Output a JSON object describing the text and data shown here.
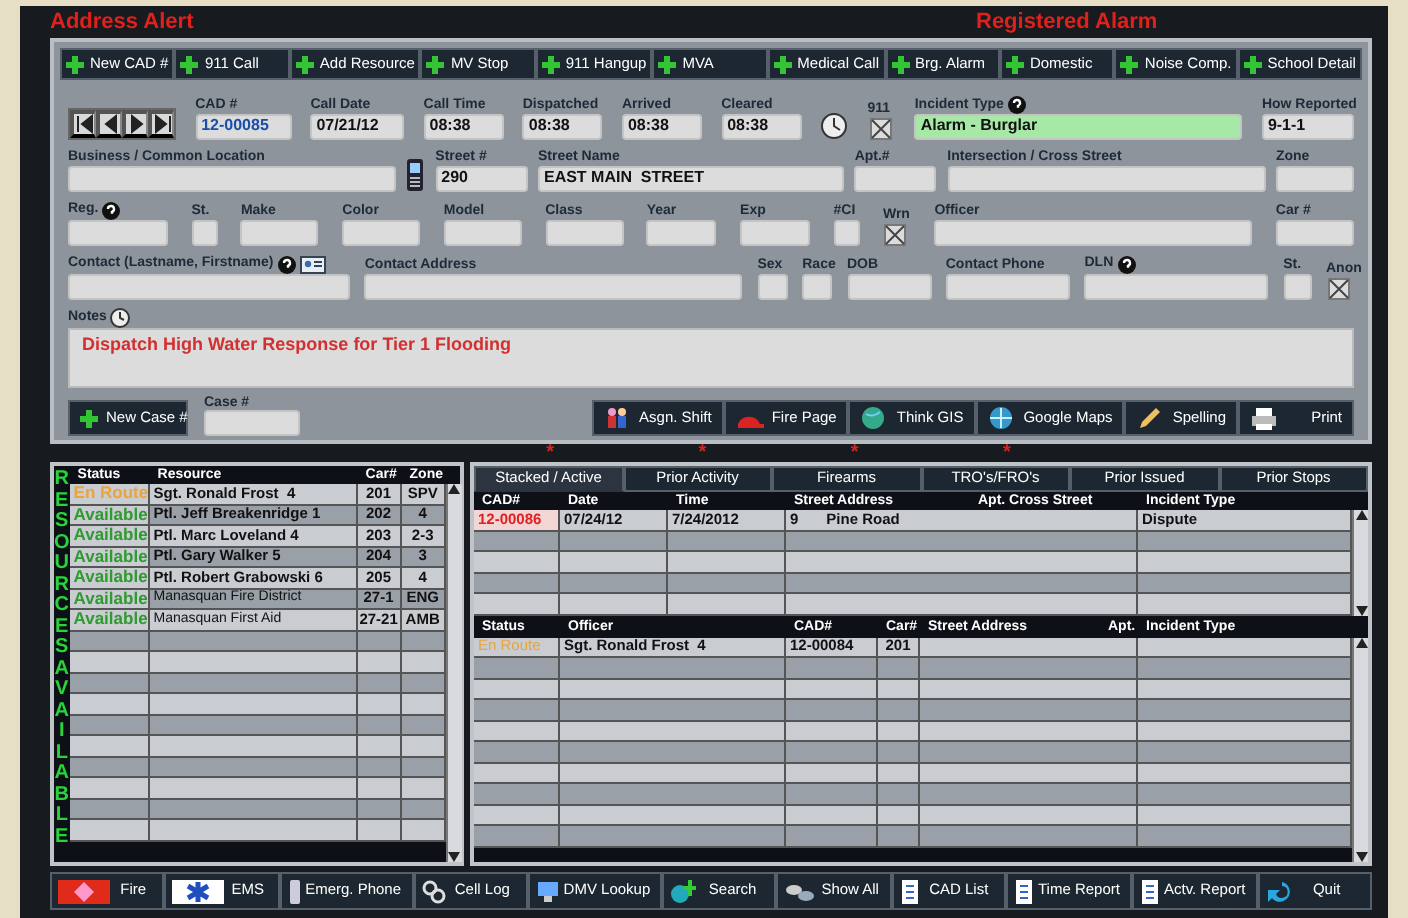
{
  "alerts": {
    "left": "Address Alert",
    "right": "Registered Alarm"
  },
  "quick_buttons": [
    "New CAD #",
    "911 Call",
    "Add Resource",
    "MV Stop",
    "911 Hangup",
    "MVA",
    "Medical Call",
    "Brg. Alarm",
    "Domestic",
    "Noise Comp.",
    "School Detail"
  ],
  "form_rows": [
    [
      {
        "label": "CAD #",
        "value": "12-00085",
        "kind": "text",
        "linked": true
      },
      {
        "label": "Call Date",
        "value": "07/21/12",
        "kind": "text"
      },
      {
        "label": "Call Time",
        "value": "08:38",
        "kind": "text"
      },
      {
        "label": "Dispatched",
        "value": "08:38",
        "kind": "text"
      },
      {
        "label": "Arrived",
        "value": "08:38",
        "kind": "text"
      },
      {
        "label": "Cleared",
        "value": "08:38",
        "kind": "text"
      },
      {
        "label": "911",
        "kind": "xbox",
        "checked": true
      },
      {
        "label": "Incident Type",
        "value": "Alarm - Burglar",
        "kind": "text",
        "help": true,
        "highlight": true
      },
      {
        "label": "How Reported",
        "value": "9-1-1",
        "kind": "text"
      }
    ],
    [
      {
        "label": "Business / Common Location",
        "kind": "text"
      },
      {
        "label": "Street #",
        "value": "290",
        "kind": "text"
      },
      {
        "label": "Street Name",
        "value": "EAST MAIN  STREET",
        "kind": "text"
      },
      {
        "label": "Apt.#",
        "kind": "text"
      },
      {
        "label": "Intersection / Cross Street",
        "kind": "text"
      },
      {
        "label": "Zone",
        "kind": "text"
      }
    ],
    [
      {
        "label": "Reg.",
        "kind": "text",
        "help": true
      },
      {
        "label": "St.",
        "kind": "text"
      },
      {
        "label": "Make",
        "kind": "text"
      },
      {
        "label": "Color",
        "kind": "text"
      },
      {
        "label": "Model",
        "kind": "text"
      },
      {
        "label": "Class",
        "kind": "text"
      },
      {
        "label": "Year",
        "kind": "text"
      },
      {
        "label": "Exp",
        "kind": "text"
      },
      {
        "label": "#CI",
        "kind": "text"
      },
      {
        "label": "Wrn",
        "kind": "xbox",
        "checked": true
      },
      {
        "label": "Officer",
        "kind": "text"
      },
      {
        "label": "Car #",
        "kind": "text"
      }
    ],
    [
      {
        "label": "Contact (Lastname, Firstname)",
        "kind": "text",
        "help": true
      },
      {
        "label": "Contact Address",
        "kind": "text"
      },
      {
        "label": "Sex",
        "kind": "text"
      },
      {
        "label": "Race",
        "kind": "text"
      },
      {
        "label": "DOB",
        "kind": "text"
      },
      {
        "label": "Contact Phone",
        "kind": "text"
      },
      {
        "label": "DLN",
        "kind": "text",
        "help": true
      },
      {
        "label": "St.",
        "kind": "text"
      },
      {
        "label": "Anon",
        "kind": "xbox",
        "checked": true
      }
    ]
  ],
  "notes": {
    "label": "Notes",
    "text": "Dispatch High Water Response for Tier 1 Flooding"
  },
  "case": {
    "button": "New Case #",
    "label": "Case #"
  },
  "action_buttons": [
    "Asgn. Shift",
    "Fire Page",
    "Think GIS",
    "Google Maps",
    "Spelling",
    "Print"
  ],
  "resources": {
    "side_label": "RESOURCES AVAILABLE",
    "columns": [
      "Status",
      "Resource",
      "Car#",
      "Zone"
    ],
    "rows": [
      {
        "status": "En Route",
        "color": "#e8a53c",
        "resource": "Sgt. Ronald Frost  4",
        "car": "201",
        "zone": "SPV",
        "kind": "officer"
      },
      {
        "status": "Available",
        "color": "#2f9a2f",
        "resource": "Ptl. Jeff Breakenridge 1",
        "car": "202",
        "zone": "4",
        "kind": "officer"
      },
      {
        "status": "Available",
        "color": "#2f9a2f",
        "resource": "Ptl. Marc Loveland 4",
        "car": "203",
        "zone": "2-3",
        "kind": "officer"
      },
      {
        "status": "Available",
        "color": "#2f9a2f",
        "resource": "Ptl. Gary Walker 5",
        "car": "204",
        "zone": "3",
        "kind": "officer"
      },
      {
        "status": "Available",
        "color": "#2f9a2f",
        "resource": "Ptl. Robert Grabowski 6",
        "car": "205",
        "zone": "4",
        "kind": "officer"
      },
      {
        "status": "Available",
        "color": "#2f9a2f",
        "resource": "Manasquan Fire District",
        "car": "27-1",
        "zone": "ENG",
        "kind": "agency"
      },
      {
        "status": "Available",
        "color": "#2f9a2f",
        "resource": "Manasquan First Aid",
        "car": "27-21",
        "zone": "AMB",
        "kind": "agency"
      }
    ]
  },
  "tabs": [
    {
      "label": "Stacked / Active",
      "selected": true,
      "marker": "*"
    },
    {
      "label": "Prior Activity",
      "selected": false,
      "marker": "*"
    },
    {
      "label": "Firearms",
      "selected": false,
      "marker": "*"
    },
    {
      "label": "TRO's/FRO's",
      "selected": false,
      "marker": "*"
    },
    {
      "label": "Prior Issued",
      "selected": false
    },
    {
      "label": "Prior Stops",
      "selected": false
    }
  ],
  "incidents": {
    "columns": [
      "CAD#",
      "Date",
      "Time",
      "Street Address",
      "Apt. Cross Street",
      "Incident Type"
    ],
    "rows": [
      {
        "cad": "12-00086",
        "date": "07/24/12",
        "time": "7/24/2012",
        "street_number": "9",
        "street_name": "Pine Road",
        "incident_type": "Dispute",
        "flagged": true
      }
    ]
  },
  "units": {
    "columns": [
      "Status",
      "Officer",
      "CAD#",
      "Car#",
      "Street Address",
      "Apt.",
      "Incident Type"
    ],
    "rows": [
      {
        "status": "En Route",
        "color": "#e8a53c",
        "officer": "Sgt. Ronald Frost  4",
        "cad": "12-00084",
        "car": "201"
      }
    ]
  },
  "bottom_buttons": [
    "Fire",
    "EMS",
    "Emerg. Phone",
    "Cell Log",
    "DMV Lookup",
    "Search",
    "Show All",
    "CAD List",
    "Time Report",
    "Actv. Report",
    "Quit"
  ]
}
